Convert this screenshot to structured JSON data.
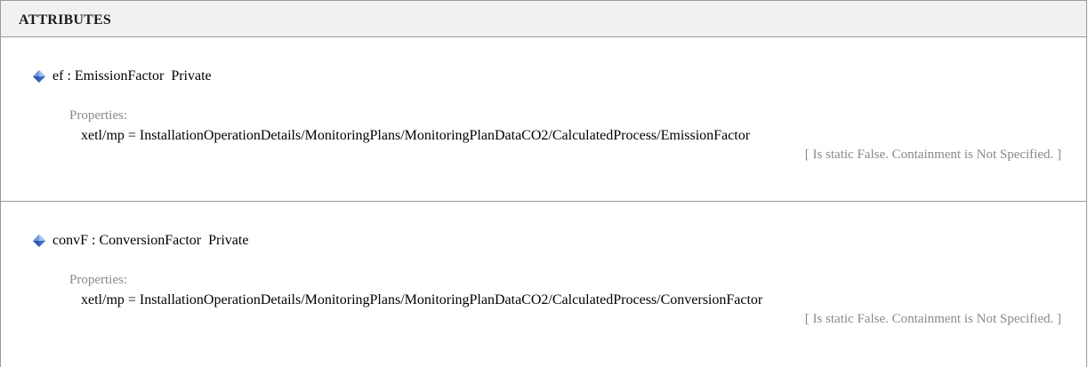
{
  "section": {
    "title": "ATTRIBUTES"
  },
  "attributes": [
    {
      "name": "ef",
      "separator": " : ",
      "type": "EmissionFactor",
      "visibility": "Private",
      "properties_label": "Properties:",
      "property": "xetl/mp = InstallationOperationDetails/MonitoringPlans/MonitoringPlanDataCO2/CalculatedProcess/EmissionFactor",
      "meta": "[ Is static False. Containment is Not Specified. ]",
      "icon": "blue-diamond-icon"
    },
    {
      "name": "convF",
      "separator": " : ",
      "type": "ConversionFactor",
      "visibility": "Private",
      "properties_label": "Properties:",
      "property": "xetl/mp = InstallationOperationDetails/MonitoringPlans/MonitoringPlanDataCO2/CalculatedProcess/ConversionFactor",
      "meta": "[ Is static False. Containment is Not Specified. ]",
      "icon": "blue-diamond-icon"
    }
  ],
  "colors": {
    "header_bg": "#f1f1f1",
    "border": "#9a9a9a",
    "muted_text": "#8a8a8a",
    "icon_blue": "#3b6fc6"
  }
}
